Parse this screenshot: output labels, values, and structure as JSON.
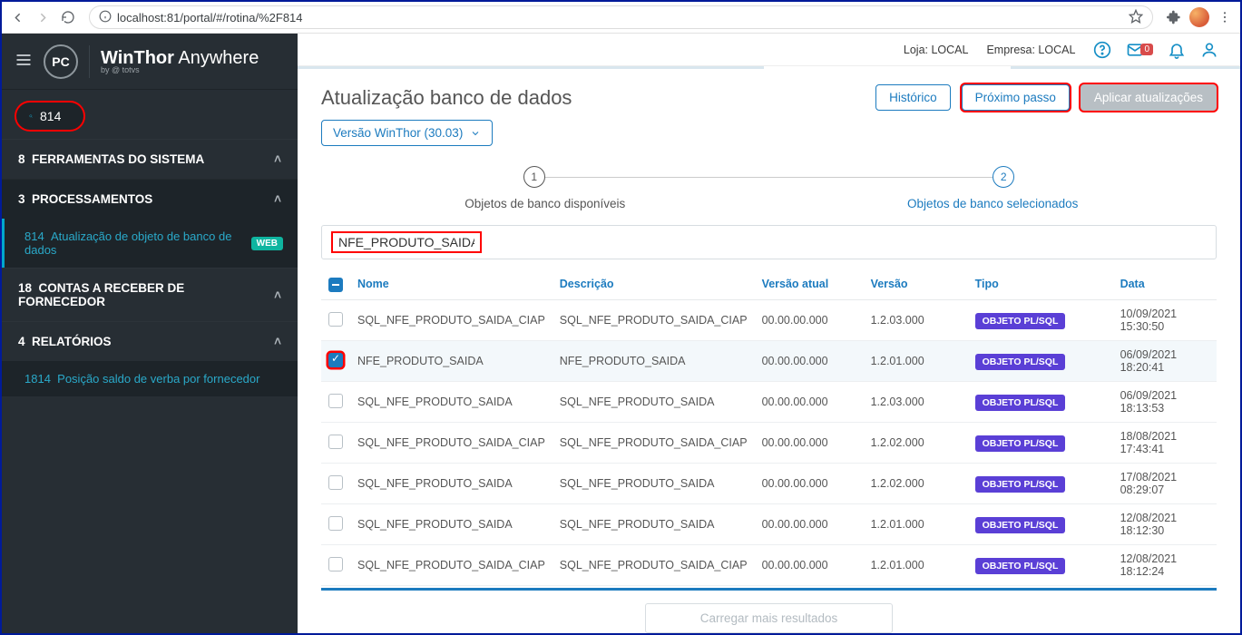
{
  "chrome": {
    "url": "localhost:81/portal/#/rotina/%2F814"
  },
  "brand": {
    "name_bold": "WinThor",
    "name_light": " Anywhere",
    "sub": "by @ totvs"
  },
  "search": {
    "value": "814"
  },
  "nav": {
    "g1": {
      "count": "8",
      "label": "FERRAMENTAS DO SISTEMA"
    },
    "g2": {
      "count": "3",
      "label": "PROCESSAMENTOS"
    },
    "g2_item": {
      "code": "814",
      "label": "Atualização de objeto de banco de dados",
      "badge": "WEB"
    },
    "g3": {
      "count": "18",
      "label": "CONTAS A RECEBER DE FORNECEDOR"
    },
    "g4": {
      "count": "4",
      "label": "RELATÓRIOS"
    },
    "g4_item": {
      "code": "1814",
      "label": "Posição saldo de verba por fornecedor"
    }
  },
  "topbar": {
    "loja": "Loja: LOCAL",
    "empresa": "Empresa: LOCAL",
    "mailcount": "0"
  },
  "page": {
    "title": "Atualização banco de dados",
    "btn_hist": "Histórico",
    "btn_next": "Próximo passo",
    "btn_apply": "Aplicar atualizações",
    "version_dd": "Versão WinThor (30.03)"
  },
  "steps": {
    "s1_num": "1",
    "s1_label": "Objetos de banco disponíveis",
    "s2_num": "2",
    "s2_label": "Objetos de banco selecionados"
  },
  "filter": {
    "value": "NFE_PRODUTO_SAIDA"
  },
  "columns": {
    "nome": "Nome",
    "desc": "Descrição",
    "vatual": "Versão atual",
    "versao": "Versão",
    "tipo": "Tipo",
    "data": "Data"
  },
  "tag_label": "OBJETO PL/SQL",
  "rows": [
    {
      "checked": false,
      "nome": "SQL_NFE_PRODUTO_SAIDA_CIAP",
      "desc": "SQL_NFE_PRODUTO_SAIDA_CIAP",
      "vatual": "00.00.00.000",
      "versao": "1.2.03.000",
      "data": "10/09/2021 15:30:50"
    },
    {
      "checked": true,
      "nome": "NFE_PRODUTO_SAIDA",
      "desc": "NFE_PRODUTO_SAIDA",
      "vatual": "00.00.00.000",
      "versao": "1.2.01.000",
      "data": "06/09/2021 18:20:41"
    },
    {
      "checked": false,
      "nome": "SQL_NFE_PRODUTO_SAIDA",
      "desc": "SQL_NFE_PRODUTO_SAIDA",
      "vatual": "00.00.00.000",
      "versao": "1.2.03.000",
      "data": "06/09/2021 18:13:53"
    },
    {
      "checked": false,
      "nome": "SQL_NFE_PRODUTO_SAIDA_CIAP",
      "desc": "SQL_NFE_PRODUTO_SAIDA_CIAP",
      "vatual": "00.00.00.000",
      "versao": "1.2.02.000",
      "data": "18/08/2021 17:43:41"
    },
    {
      "checked": false,
      "nome": "SQL_NFE_PRODUTO_SAIDA",
      "desc": "SQL_NFE_PRODUTO_SAIDA",
      "vatual": "00.00.00.000",
      "versao": "1.2.02.000",
      "data": "17/08/2021 08:29:07"
    },
    {
      "checked": false,
      "nome": "SQL_NFE_PRODUTO_SAIDA",
      "desc": "SQL_NFE_PRODUTO_SAIDA",
      "vatual": "00.00.00.000",
      "versao": "1.2.01.000",
      "data": "12/08/2021 18:12:30"
    },
    {
      "checked": false,
      "nome": "SQL_NFE_PRODUTO_SAIDA_CIAP",
      "desc": "SQL_NFE_PRODUTO_SAIDA_CIAP",
      "vatual": "00.00.00.000",
      "versao": "1.2.01.000",
      "data": "12/08/2021 18:12:24"
    }
  ],
  "load_more": "Carregar mais resultados"
}
